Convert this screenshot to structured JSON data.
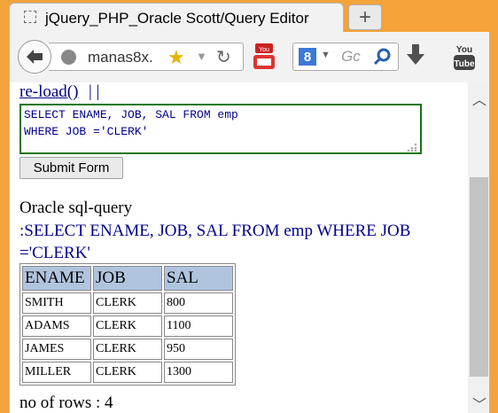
{
  "browser": {
    "tab_title": "jQuery_PHP_Oracle Scott/Query Editor",
    "new_tab_label": "+",
    "url": "manas8x.",
    "search_placeholder": "Gc",
    "search_engine_letter": "8"
  },
  "page": {
    "reload_link": "re-load()",
    "reload_separator": "| |",
    "query_text": "SELECT ENAME, JOB, SAL FROM emp\nWHERE JOB ='CLERK'",
    "submit_label": "Submit Form",
    "oracle_label": "Oracle sql-query",
    "sql_echo": ":SELECT ENAME, JOB, SAL FROM emp WHERE JOB ='CLERK'",
    "table": {
      "headers": [
        "ENAME",
        "JOB",
        "SAL"
      ],
      "rows": [
        [
          "SMITH",
          "CLERK",
          "800"
        ],
        [
          "ADAMS",
          "CLERK",
          "1100"
        ],
        [
          "JAMES",
          "CLERK",
          "950"
        ],
        [
          "MILLER",
          "CLERK",
          "1300"
        ]
      ]
    },
    "row_count_text": "no of rows : 4"
  },
  "colors": {
    "window_frame": "#f3a33a",
    "link_blue": "#00008b",
    "query_border": "#117711",
    "table_header_bg": "#b0c4de"
  },
  "icons": [
    "tab-favicon-icon",
    "back-arrow-icon",
    "globe-icon",
    "star-icon",
    "dropdown-icon",
    "reload-icon",
    "youtube-icon",
    "google-icon",
    "magnifier-icon",
    "download-icon",
    "youtube-icon"
  ]
}
